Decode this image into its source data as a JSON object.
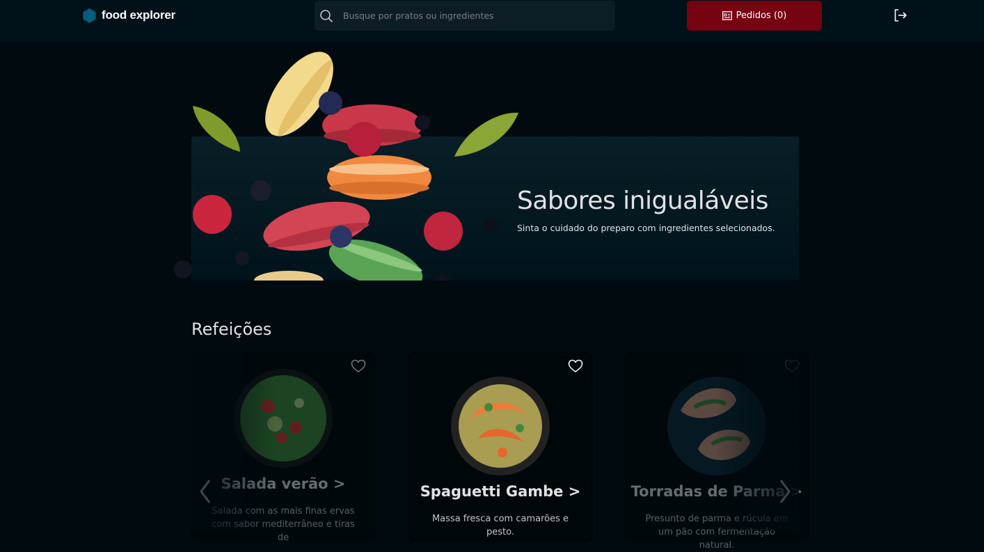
{
  "header": {
    "brand": "food explorer",
    "search_placeholder": "Busque por pratos ou ingredientes",
    "orders_label": "Pedidos (0)"
  },
  "banner": {
    "title": "Sabores inigualáveis",
    "subtitle": "Sinta o cuidado do preparo com ingredientes selecionados."
  },
  "section": {
    "title": "Refeições",
    "dishes": [
      {
        "name": "Salada verão >",
        "description": "Salada com as mais finas ervas com sabor mediterrâneo e tiras de"
      },
      {
        "name": "Spaguetti Gambe >",
        "description": "Massa fresca com camarões e pesto."
      },
      {
        "name": "Torradas de Parma >",
        "description": "Presunto de parma e rúcula em um pão com fermentação natural."
      }
    ]
  },
  "colors": {
    "accent": "#750310",
    "logo": "#065e7c",
    "background": "#000a0f",
    "header": "#00111a"
  },
  "icons": [
    "logo-hexagon-icon",
    "search-icon",
    "receipt-icon",
    "logout-icon",
    "heart-icon",
    "chevron-left-icon",
    "chevron-right-icon"
  ]
}
